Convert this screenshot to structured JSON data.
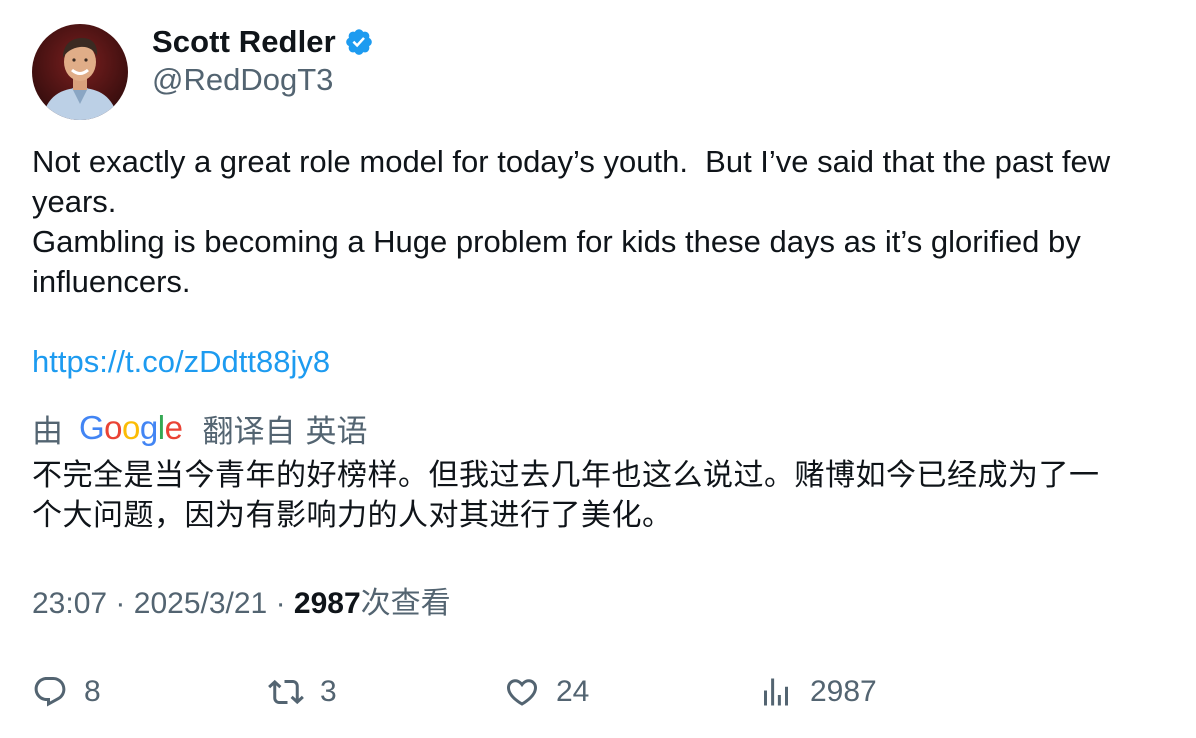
{
  "user": {
    "display_name": "Scott Redler",
    "handle": "@RedDogT3",
    "verified": true,
    "verified_color": "#1d9bf0"
  },
  "tweet": {
    "lines": [
      "Not exactly a great role model for today’s youth.  But I’ve said that the past few",
      "years.",
      "Gambling is becoming a Huge problem for kids these days as it’s glorified by",
      "influencers."
    ],
    "link": "https://t.co/zDdtt88jy8",
    "link_color": "#1d9bf0"
  },
  "translation": {
    "by_label": "由",
    "provider": "Google",
    "from_label": "翻译自",
    "language": "英语",
    "lines": [
      "不完全是当今青年的好榜样。但我过去几年也这么说过。赌博如今已经成为了一",
      "个大问题，因为有影响力的人对其进行了美化。"
    ]
  },
  "meta": {
    "time": "23:07",
    "separator": "·",
    "date": "2025/3/21",
    "views_count": "2987",
    "views_label": "次查看"
  },
  "actions": {
    "reply": {
      "icon": "reply-icon",
      "count": "8"
    },
    "retweet": {
      "icon": "retweet-icon",
      "count": "3"
    },
    "like": {
      "icon": "heart-icon",
      "count": "24"
    },
    "views": {
      "icon": "views-chart-icon",
      "count": "2987"
    }
  },
  "colors": {
    "text_primary": "#0f1419",
    "text_secondary": "#536471",
    "accent": "#1d9bf0"
  }
}
